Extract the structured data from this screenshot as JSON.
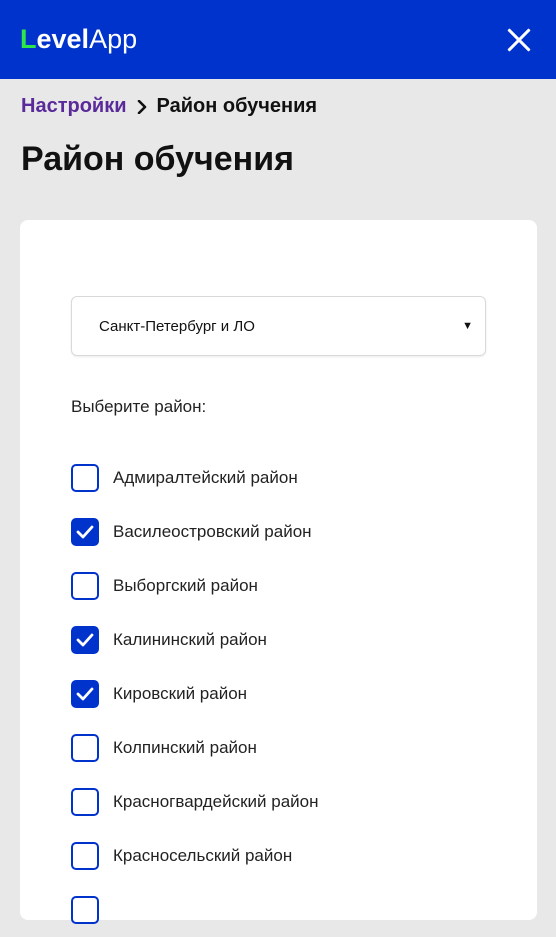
{
  "header": {
    "logo_l": "L",
    "logo_evel": "evel",
    "logo_app": "App"
  },
  "breadcrumb": {
    "parent": "Настройки",
    "current": "Район обучения"
  },
  "page": {
    "title": "Район обучения"
  },
  "region_select": {
    "value": "Санкт-Петербург и ЛО"
  },
  "district_prompt": "Выберите район:",
  "districts": [
    {
      "label": "Адмиралтейский район",
      "checked": false
    },
    {
      "label": "Василеостровский район",
      "checked": true
    },
    {
      "label": "Выборгский район",
      "checked": false
    },
    {
      "label": "Калининский район",
      "checked": true
    },
    {
      "label": "Кировский район",
      "checked": true
    },
    {
      "label": "Колпинский район",
      "checked": false
    },
    {
      "label": "Красногвардейский район",
      "checked": false
    },
    {
      "label": "Красносельский район",
      "checked": false
    },
    {
      "label": "",
      "checked": false
    }
  ],
  "colors": {
    "brand": "#0033cc",
    "logo_accent": "#2ee54a",
    "breadcrumb_link": "#5a2a9a"
  }
}
